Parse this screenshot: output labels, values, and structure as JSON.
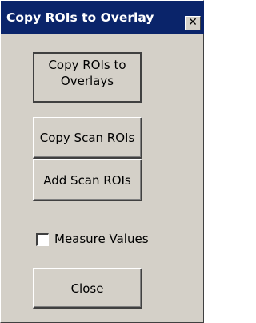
{
  "window": {
    "title": "Copy ROIs to Overlay",
    "close_glyph": "✕"
  },
  "buttons": {
    "copy_to_overlays": "Copy ROIs to\nOverlays",
    "copy_scan_rois": "Copy Scan ROIs",
    "add_scan_rois": "Add Scan ROIs",
    "close": "Close"
  },
  "measure_values": {
    "label": "Measure Values",
    "checked": false
  },
  "colors": {
    "titlebar": "#0a246a",
    "face": "#d4d0c8"
  }
}
